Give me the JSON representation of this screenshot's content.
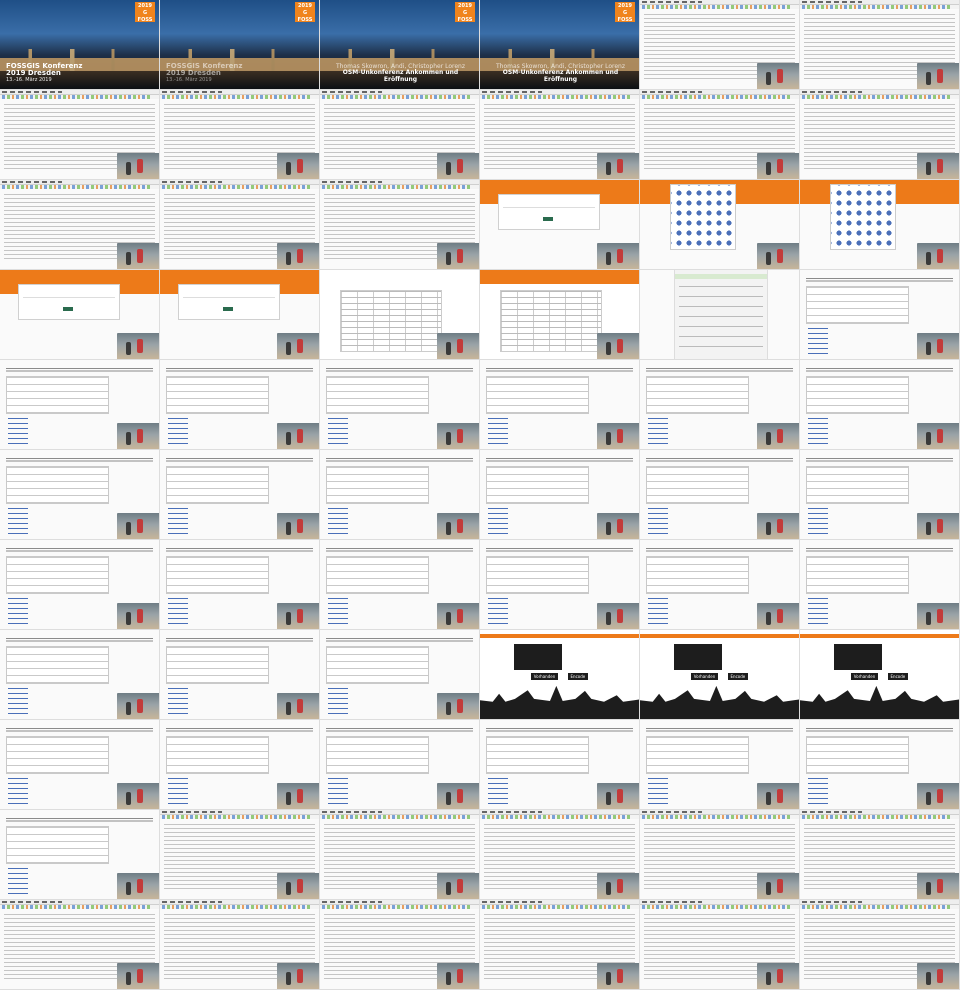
{
  "title_slide_1": {
    "logo_top": "2019",
    "logo_mid": "G",
    "logo_bottom": "FOSS",
    "line1": "FOSSGIS Konferenz",
    "line2": "2019 Dresden",
    "line3": "13.-16. März 2019"
  },
  "title_slide_2": {
    "logo_top": "2019",
    "logo_mid": "G",
    "logo_bottom": "FOSS",
    "names": "Thomas Skowron, Andi, Christopher Lorenz",
    "talk": "OSM-Unkonferenz Ankommen und Eröffnung"
  },
  "stream_screen": {
    "left_button": "Vorhanden",
    "right_button": "Encode"
  }
}
